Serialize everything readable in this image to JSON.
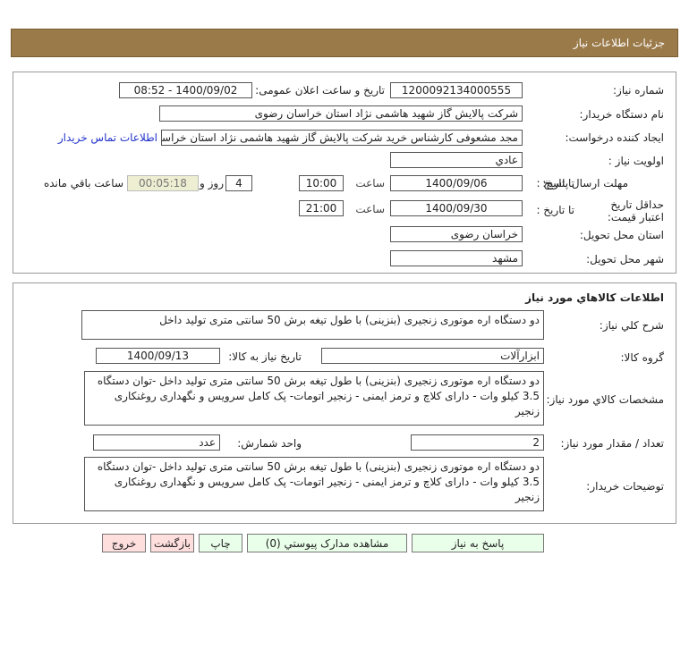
{
  "header": {
    "title": "جزئیات اطلاعات نیاز"
  },
  "info": {
    "need_number_label": "شماره نیاز:",
    "need_number": "1200092134000555",
    "announce_label": "تاریخ و ساعت اعلان عمومی:",
    "announce_value": "1400/09/02 - 08:52",
    "buyer_label": "نام دستگاه خریدار:",
    "buyer_value": "شرکت پالایش گاز شهید هاشمی نژاد   استان خراسان رضوی",
    "creator_label": "ایجاد کننده درخواست:",
    "creator_value": "مجد مشعوفی کارشناس خرید شرکت پالایش گاز شهید هاشمی نژاد   استان خراسان رضوی",
    "contact_link": "اطلاعات تماس خریدار",
    "priority_label": "اولویت نیاز :",
    "priority_value": "عادي",
    "deadline_label": "مهلت ارسال پاسخ:",
    "to_date_label": "تا تاریخ :",
    "deadline_date": "1400/09/06",
    "time_label": "ساعت",
    "deadline_time": "10:00",
    "days_value": "4",
    "days_label": "روز و",
    "remaining_time": "00:05:18",
    "remaining_label": "ساعت باقي مانده",
    "validity_label": "حداقل تاریخ اعتبار قیمت:",
    "validity_date": "1400/09/30",
    "validity_time": "21:00",
    "province_label": "استان محل تحویل:",
    "province_value": "خراسان رضوی",
    "city_label": "شهر محل تحویل:",
    "city_value": "مشهد"
  },
  "goods": {
    "title": "اطلاعات کالاهاي مورد نياز",
    "summary_label": "شرح کلي نياز:",
    "summary_value": "دو دستگاه اره موتوری زنجیری (بنزینی) با طول  تیغه برش 50 سانتی متری تولید داخل",
    "group_label": "گروه کالا:",
    "group_value": "ابزارآلات",
    "need_date_label": "تاریخ نیاز به کالا:",
    "need_date_value": "1400/09/13",
    "spec_label": "مشخصات کالاي مورد نياز:",
    "spec_value": "دو دستگاه اره موتوری زنجیری (بنزینی) با طول  تیغه برش 50 سانتی متری تولید داخل -توان دستگاه 3.5 کیلو وات - دارای کلاچ و ترمز ایمنی - زنجیر اتومات- پک کامل سرویس و نگهداری روغنکاری زنجیر",
    "qty_label": "تعداد / مقدار مورد نیاز:",
    "qty_value": "2",
    "unit_label": "واحد شمارش:",
    "unit_value": "عدد",
    "desc_label": "توضیحات خریدار:",
    "desc_value": "دو دستگاه اره موتوری زنجیری (بنزینی) با طول  تیغه برش 50 سانتی متری تولید داخل -توان دستگاه 3.5 کیلو وات - دارای کلاچ و ترمز ایمنی - زنجیر اتومات- پک کامل سرویس و نگهداری روغنکاری زنجیر"
  },
  "buttons": {
    "reply": "پاسخ به نیاز",
    "attachments": "مشاهده مدارک پیوستي (0)",
    "print": "چاپ",
    "back": "بازگشت",
    "exit": "خروج"
  }
}
